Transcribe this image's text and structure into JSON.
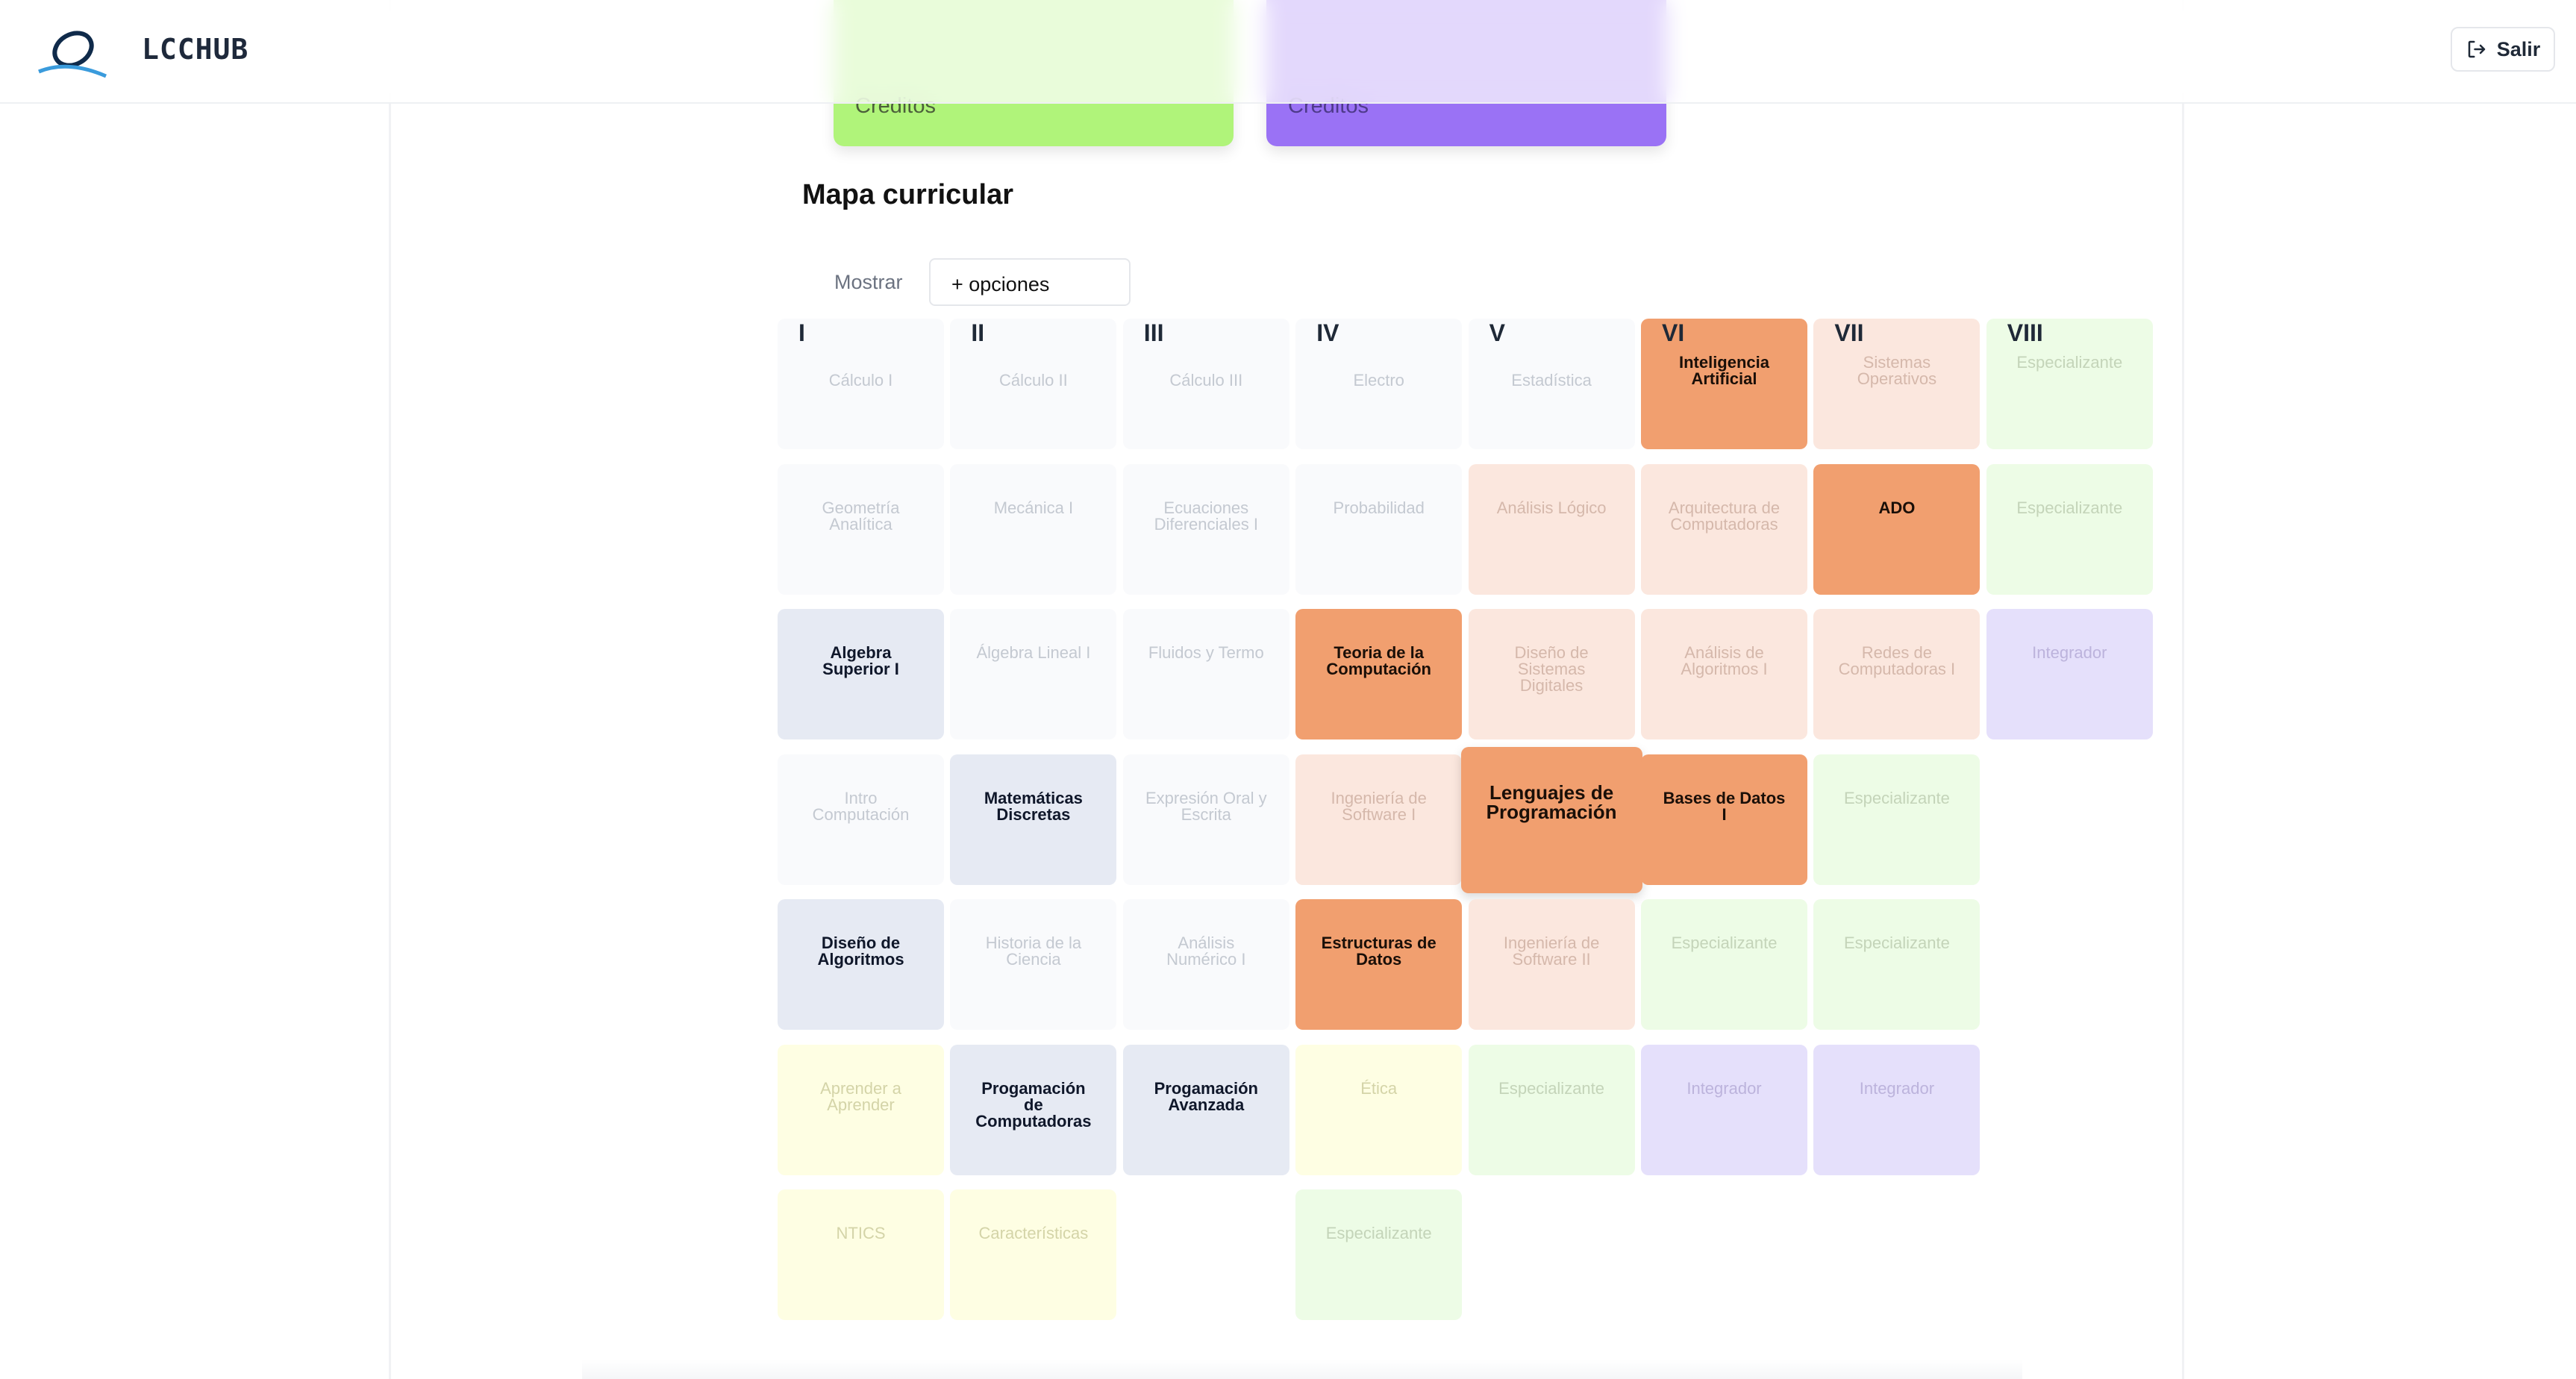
{
  "app": {
    "brand": "LCCHUB",
    "logout_label": "Salir"
  },
  "cards": [
    {
      "label": "Creditos",
      "color": "#b0f47a"
    },
    {
      "label": "Creditos",
      "color": "#9a72f5"
    }
  ],
  "section": {
    "title": "Mapa curricular",
    "show_label": "Mostrar",
    "options_value": "+ opciones"
  },
  "semesters": [
    "I",
    "II",
    "III",
    "IV",
    "V",
    "VI",
    "VII",
    "VIII"
  ],
  "colors": {
    "pending": "#f9fafc",
    "completed": "#e6eaf3",
    "current": "#f19f6f",
    "elective": "#edfce6",
    "integrator": "#e5e0fb",
    "extra": "#fefee3",
    "peach": "#fbe7de"
  },
  "grid": [
    [
      {
        "name": "Cálculo I",
        "s": "gray"
      },
      {
        "name": "Cálculo II",
        "s": "gray"
      },
      {
        "name": "Cálculo III",
        "s": "gray"
      },
      {
        "name": "Electro",
        "s": "gray"
      },
      {
        "name": "Estadística",
        "s": "gray"
      },
      {
        "name": "Inteligencia Artificial",
        "s": "orange"
      },
      {
        "name": "Sistemas Operativos",
        "s": "peach"
      },
      {
        "name": "Especializante",
        "s": "green"
      }
    ],
    [
      {
        "name": "Geometría Analítica",
        "s": "gray"
      },
      {
        "name": "Mecánica I",
        "s": "gray"
      },
      {
        "name": "Ecuaciones Diferenciales I",
        "s": "gray"
      },
      {
        "name": "Probabilidad",
        "s": "gray"
      },
      {
        "name": "Análisis Lógico",
        "s": "peach"
      },
      {
        "name": "Arquitectura de Computadoras",
        "s": "peach"
      },
      {
        "name": "ADO",
        "s": "orange"
      },
      {
        "name": "Especializante",
        "s": "green"
      }
    ],
    [
      {
        "name": "Algebra Superior I",
        "s": "grayA"
      },
      {
        "name": "Álgebra Lineal I",
        "s": "gray"
      },
      {
        "name": "Fluidos y Termo",
        "s": "gray"
      },
      {
        "name": "Teoria de la Computación",
        "s": "orange"
      },
      {
        "name": "Diseño de Sistemas Digitales",
        "s": "peach"
      },
      {
        "name": "Análisis de Algoritmos I",
        "s": "peach"
      },
      {
        "name": "Redes de Computadoras I",
        "s": "peach"
      },
      {
        "name": "Integrador",
        "s": "violet"
      }
    ],
    [
      {
        "name": "Intro Computación",
        "s": "gray"
      },
      {
        "name": "Matemáticas Discretas",
        "s": "grayA"
      },
      {
        "name": "Expresión Oral y Escrita",
        "s": "gray"
      },
      {
        "name": "Ingeniería de Software I",
        "s": "peach"
      },
      {
        "name": "Lenguajes de Programación",
        "s": "orange",
        "big": true
      },
      {
        "name": "Bases de Datos I",
        "s": "orange"
      },
      {
        "name": "Especializante",
        "s": "green"
      },
      null
    ],
    [
      {
        "name": "Diseño de Algoritmos",
        "s": "grayA"
      },
      {
        "name": "Historia de la Ciencia",
        "s": "gray"
      },
      {
        "name": "Análisis Numérico I",
        "s": "gray"
      },
      {
        "name": "Estructuras de Datos",
        "s": "orange"
      },
      {
        "name": "Ingeniería de Software II",
        "s": "peach"
      },
      {
        "name": "Especializante",
        "s": "green"
      },
      {
        "name": "Especializante",
        "s": "green"
      },
      null
    ],
    [
      {
        "name": "Aprender a Aprender",
        "s": "yellow"
      },
      {
        "name": "Progamación de Computadoras",
        "s": "grayA"
      },
      {
        "name": "Progamación Avanzada",
        "s": "grayA"
      },
      {
        "name": "Ética",
        "s": "yellow"
      },
      {
        "name": "Especializante",
        "s": "green"
      },
      {
        "name": "Integrador",
        "s": "violet"
      },
      {
        "name": "Integrador",
        "s": "violet"
      },
      null
    ],
    [
      {
        "name": "NTICS",
        "s": "yellow"
      },
      {
        "name": "Características",
        "s": "yellow"
      },
      null,
      {
        "name": "Especializante",
        "s": "green"
      },
      null,
      null,
      null,
      null
    ]
  ]
}
